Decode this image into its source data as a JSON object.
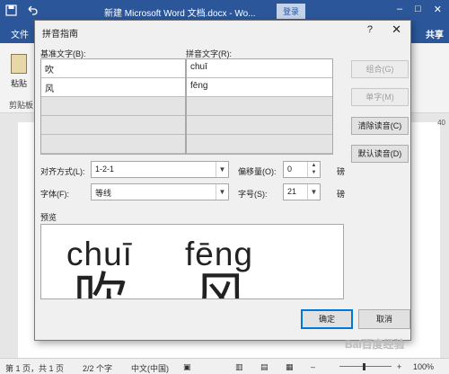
{
  "word": {
    "title": "新建 Microsoft Word 文档.docx  -  Wo...",
    "login": "登录",
    "file_tab": "文件",
    "share": "共享",
    "paste_label": "粘贴",
    "clipboard_label": "剪贴板",
    "ruler_number": "40"
  },
  "dialog": {
    "title": "拼音指南",
    "help": "?",
    "base_text_label": "基准文字(B):",
    "ruby_text_label": "拼音文字(R):",
    "rows": [
      {
        "base": "吹",
        "ruby": "chuī"
      },
      {
        "base": "风",
        "ruby": "fēng"
      },
      {
        "base": "",
        "ruby": ""
      },
      {
        "base": "",
        "ruby": ""
      },
      {
        "base": "",
        "ruby": ""
      }
    ],
    "buttons": {
      "group": "组合(G)",
      "mono": "单字(M)",
      "clear": "清除读音(C)",
      "default": "默认读音(D)",
      "ok": "确定",
      "cancel": "取消"
    },
    "alignment_label": "对齐方式(L):",
    "alignment_value": "1-2-1",
    "offset_label": "偏移量(O):",
    "offset_value": "0",
    "offset_unit": "磅",
    "font_label": "字体(F):",
    "font_value": "等线",
    "size_label": "字号(S):",
    "size_value": "21",
    "size_unit": "磅",
    "preview_label": "预览",
    "preview": {
      "ruby_1": "chuī",
      "ruby_2": "fēng",
      "base_1": "吹",
      "base_2": "风"
    }
  },
  "status": {
    "page": "第 1 页，共 1 页",
    "words": "2/2 个字",
    "language": "中文(中国)",
    "zoom": "100%"
  },
  "watermark": "Bai百度经验"
}
